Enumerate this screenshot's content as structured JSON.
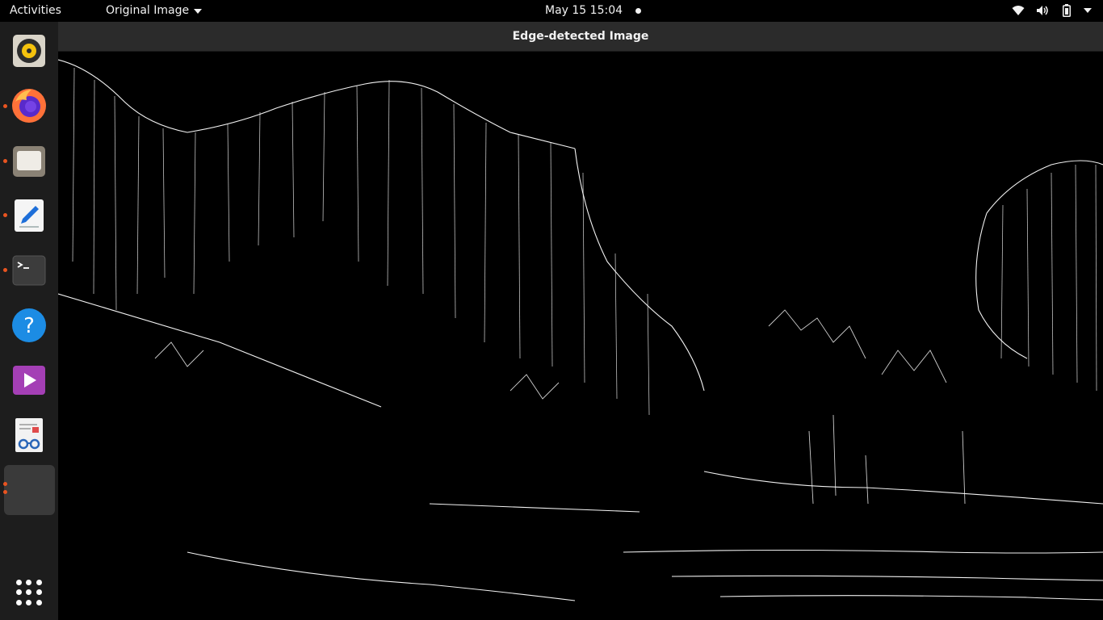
{
  "topbar": {
    "activities": "Activities",
    "app_menu": "Original Image",
    "clock": "May 15  15:04"
  },
  "dock": {
    "items": [
      {
        "name": "rhythmbox-icon"
      },
      {
        "name": "firefox-icon"
      },
      {
        "name": "files-icon"
      },
      {
        "name": "text-editor-icon"
      },
      {
        "name": "terminal-icon"
      },
      {
        "name": "help-icon"
      },
      {
        "name": "video-player-icon"
      },
      {
        "name": "document-viewer-icon"
      },
      {
        "name": "active-app-slot"
      }
    ],
    "show_apps": "show-apps-icon"
  },
  "window": {
    "title": "Edge-detected Image"
  },
  "colors": {
    "topbar": "#000000",
    "dock": "#1d1d1d",
    "accent": "#e95420",
    "window_header": "#2b2b2b"
  }
}
